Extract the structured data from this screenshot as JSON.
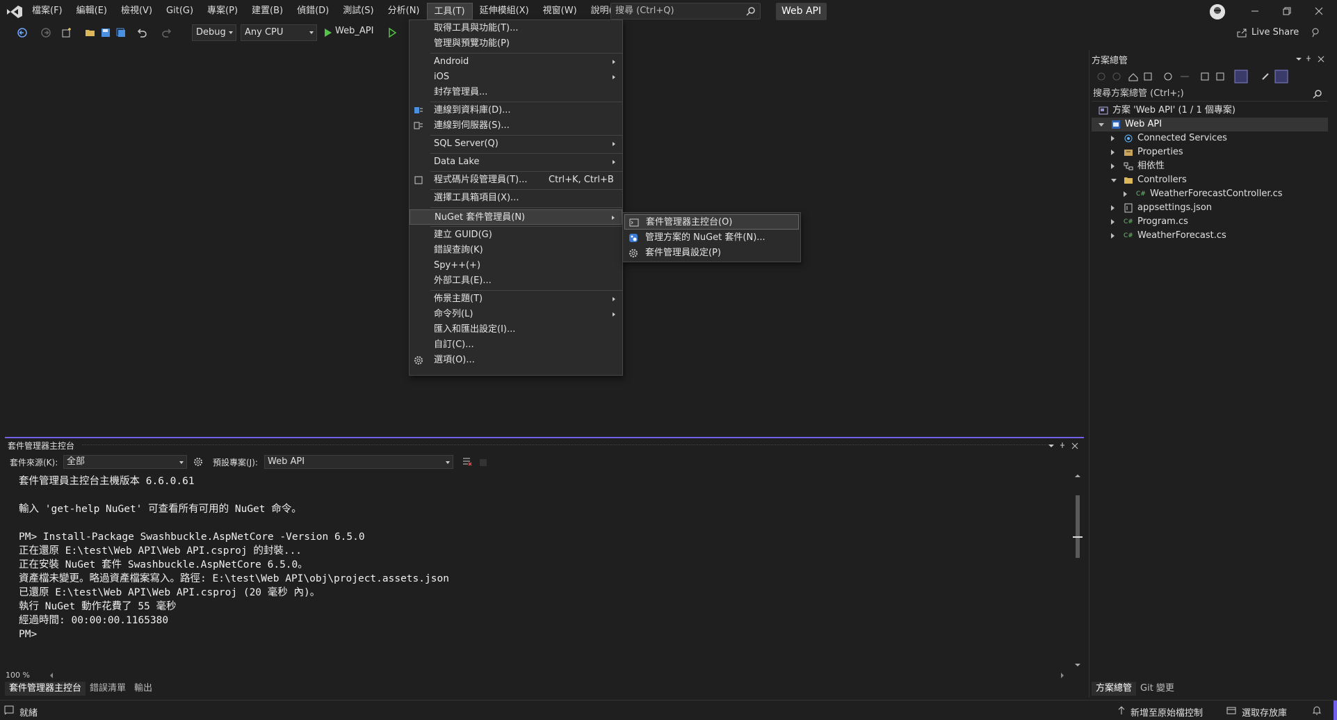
{
  "menubar": {
    "items": [
      "檔案(F)",
      "編輯(E)",
      "檢視(V)",
      "Git(G)",
      "專案(P)",
      "建置(B)",
      "偵錯(D)",
      "測試(S)",
      "分析(N)",
      "工具(T)",
      "延伸模組(X)",
      "視窗(W)",
      "說明(H)"
    ],
    "search_placeholder": "搜尋 (Ctrl+Q)",
    "solution_name": "Web API"
  },
  "toolbar": {
    "config": "Debug",
    "platform": "Any CPU",
    "run_target": "Web_API",
    "live_share": "Live Share"
  },
  "tools_menu": {
    "items": [
      {
        "label": "取得工具與功能(T)..."
      },
      {
        "label": "管理與預覽功能(P)"
      },
      {
        "label": "Android"
      },
      {
        "label": "iOS"
      },
      {
        "label": "封存管理員..."
      },
      {
        "label": "連線到資料庫(D)..."
      },
      {
        "label": "連線到伺服器(S)..."
      },
      {
        "label": "SQL Server(Q)"
      },
      {
        "label": "Data Lake"
      },
      {
        "label": "程式碼片段管理員(T)...",
        "shortcut": "Ctrl+K, Ctrl+B"
      },
      {
        "label": "選擇工具箱項目(X)..."
      },
      {
        "label": "NuGet 套件管理員(N)"
      },
      {
        "label": "建立 GUID(G)"
      },
      {
        "label": "錯誤查詢(K)"
      },
      {
        "label": "Spy++(+)"
      },
      {
        "label": "外部工具(E)..."
      },
      {
        "label": "佈景主題(T)"
      },
      {
        "label": "命令列(L)"
      },
      {
        "label": "匯入和匯出設定(I)..."
      },
      {
        "label": "自訂(C)..."
      },
      {
        "label": "選項(O)..."
      }
    ]
  },
  "nuget_menu": {
    "items": [
      {
        "label": "套件管理器主控台(O)"
      },
      {
        "label": "管理方案的 NuGet 套件(N)..."
      },
      {
        "label": "套件管理員設定(P)"
      }
    ]
  },
  "solution_explorer": {
    "title": "方案總管",
    "search_placeholder": "搜尋方案總管 (Ctrl+;)",
    "tree": [
      {
        "label": "方案 'Web API' (1 / 1 個專案)"
      },
      {
        "label": "Web API"
      },
      {
        "label": "Connected Services"
      },
      {
        "label": "Properties"
      },
      {
        "label": "相依性"
      },
      {
        "label": "Controllers"
      },
      {
        "label": "WeatherForecastController.cs"
      },
      {
        "label": "appsettings.json"
      },
      {
        "label": "Program.cs"
      },
      {
        "label": "WeatherForecast.cs"
      }
    ],
    "tabs": [
      "方案總管",
      "Git 變更"
    ]
  },
  "pmc": {
    "title": "套件管理器主控台",
    "source_label": "套件來源(K):",
    "source_value": "全部",
    "project_label": "預設專案(J):",
    "project_value": "Web API",
    "console_lines": "套件管理員主控台主機版本 6.6.0.61\n\n輸入 'get-help NuGet' 可查看所有可用的 NuGet 命令。\n\nPM> Install-Package Swashbuckle.AspNetCore -Version 6.5.0\n正在還原 E:\\test\\Web API\\Web API.csproj 的封裝...\n正在安裝 NuGet 套件 Swashbuckle.AspNetCore 6.5.0。\n資產檔未變更。略過資產檔案寫入。路徑: E:\\test\\Web API\\obj\\project.assets.json\n已還原 E:\\test\\Web API\\Web API.csproj (20 毫秒 內)。\n執行 NuGet 動作花費了 55 毫秒\n經過時間: 00:00:00.1165380\nPM>",
    "zoom": "100 %",
    "tabs": [
      "套件管理器主控台",
      "錯誤清單",
      "輸出"
    ]
  },
  "statusbar": {
    "status": "就緒",
    "source_control": "新增至原始檔控制",
    "repo": "選取存放庫"
  },
  "colors": {
    "accent": "#7160e8",
    "background": "#1f1f1f",
    "menu_bg": "#2b2b2b"
  }
}
